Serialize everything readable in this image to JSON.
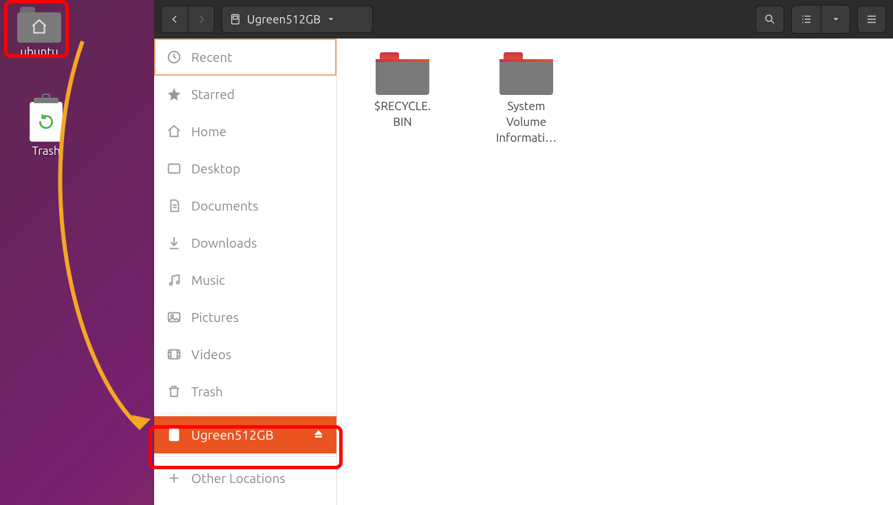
{
  "desktop": {
    "home_label": "ubuntu",
    "trash_label": "Trash"
  },
  "titlebar": {
    "location": "Ugreen512GB"
  },
  "sidebar": {
    "items": [
      {
        "icon": "clock",
        "label": "Recent"
      },
      {
        "icon": "star",
        "label": "Starred"
      },
      {
        "icon": "home",
        "label": "Home"
      },
      {
        "icon": "desktop",
        "label": "Desktop"
      },
      {
        "icon": "document",
        "label": "Documents"
      },
      {
        "icon": "download",
        "label": "Downloads"
      },
      {
        "icon": "music",
        "label": "Music"
      },
      {
        "icon": "picture",
        "label": "Pictures"
      },
      {
        "icon": "video",
        "label": "Videos"
      },
      {
        "icon": "trash",
        "label": "Trash"
      }
    ],
    "device": {
      "label": "Ugreen512GB"
    },
    "other": {
      "label": "Other Locations"
    }
  },
  "files": [
    {
      "label": "$RECYCLE.\nBIN"
    },
    {
      "label": "System\nVolume\nInformati…"
    }
  ],
  "colors": {
    "accent": "#e95420",
    "annotation_red": "#ff0000",
    "annotation_orange": "#f5a623"
  }
}
